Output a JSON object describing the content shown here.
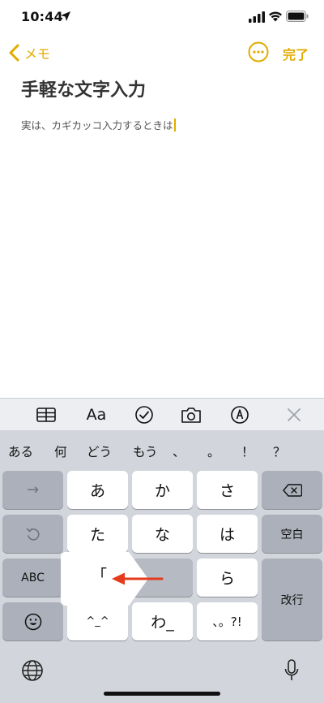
{
  "status_bar": {
    "time": "10:44"
  },
  "nav": {
    "back_label": "メモ",
    "done_label": "完了"
  },
  "note": {
    "title": "手軽な文字入力",
    "body": "実は、カギカッコ入力するときは"
  },
  "keyboard": {
    "toolbar": {
      "format_label": "Aa"
    },
    "suggestions": [
      "ある",
      "何",
      "どう",
      "もう",
      "、",
      "。",
      "！",
      "？"
    ],
    "keys": {
      "a": "あ",
      "ka": "か",
      "sa": "さ",
      "ta": "た",
      "na": "な",
      "ha": "は",
      "ra": "ら",
      "kaomoji": "^_^",
      "wa": "わ_",
      "punct": "、。?!",
      "abc": "ABC",
      "space": "空白",
      "return": "改行",
      "arrow": "→"
    },
    "popup_char": "「"
  },
  "colors": {
    "accent": "#e2ab00",
    "arrow_red": "#e53a1c",
    "keyboard_bg": "#d2d5db",
    "func_key": "#abb0ba"
  }
}
